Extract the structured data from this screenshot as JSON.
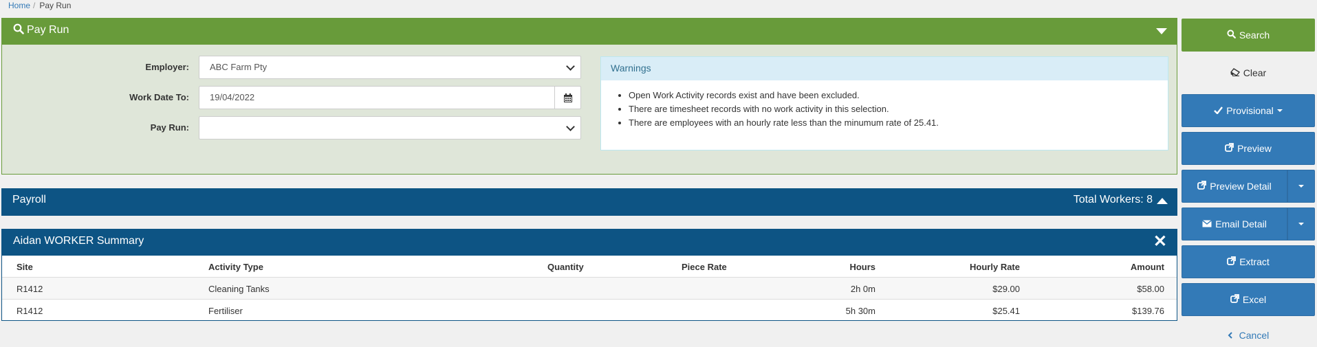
{
  "breadcrumb": {
    "home": "Home",
    "separator": "/",
    "current": "Pay Run"
  },
  "payrun_panel": {
    "title": "Pay Run",
    "form": {
      "employer_label": "Employer:",
      "employer_value": "ABC Farm Pty",
      "work_date_label": "Work Date To:",
      "work_date_value": "19/04/2022",
      "pay_run_label": "Pay Run:",
      "pay_run_value": ""
    },
    "warnings": {
      "title": "Warnings",
      "items": [
        "Open Work Activity records exist and have been excluded.",
        "There are timesheet records with no work activity in this selection.",
        "There are employees with an hourly rate less than the minumum rate of 25.41."
      ]
    }
  },
  "payroll": {
    "title": "Payroll",
    "total_workers": "Total Workers: 8"
  },
  "summary": {
    "title": "Aidan WORKER Summary",
    "close": "✕",
    "columns": [
      "Site",
      "Activity Type",
      "Quantity",
      "Piece Rate",
      "Hours",
      "Hourly Rate",
      "Amount"
    ],
    "rows": [
      {
        "site": "R1412",
        "activity": "Cleaning Tanks",
        "quantity": "",
        "piece_rate": "",
        "hours": "2h 0m",
        "hourly_rate": "$29.00",
        "amount": "$58.00"
      },
      {
        "site": "R1412",
        "activity": "Fertiliser",
        "quantity": "",
        "piece_rate": "",
        "hours": "5h 30m",
        "hourly_rate": "$25.41",
        "amount": "$139.76"
      }
    ]
  },
  "actions": {
    "search": "Search",
    "clear": "Clear",
    "provisional": "Provisional",
    "preview": "Preview",
    "preview_detail": "Preview Detail",
    "email_detail": "Email Detail",
    "extract": "Extract",
    "excel": "Excel",
    "cancel": "Cancel"
  },
  "colors": {
    "green": "#689b3a",
    "navy": "#0d5484",
    "blue": "#337ab7",
    "warn_bg": "#d9edf7"
  }
}
